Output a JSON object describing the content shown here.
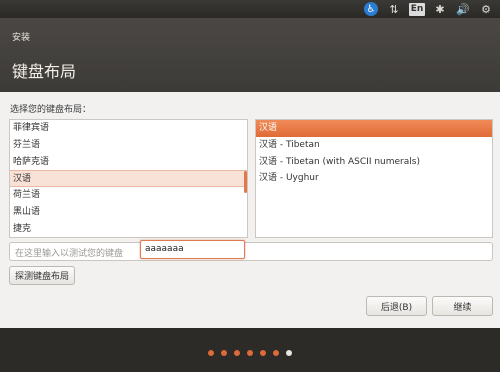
{
  "top_panel": {
    "keyboard_indicator": "En",
    "icons": [
      "accessibility-icon",
      "network-icon",
      "keyboard-layout-indicator",
      "bluetooth-icon",
      "volume-icon",
      "gear-icon"
    ]
  },
  "window": {
    "title": "安装",
    "page_title": "键盘布局"
  },
  "main": {
    "prompt": "选择您的键盘布局：",
    "languages": [
      "菲律宾语",
      "芬兰语",
      "哈萨克语",
      "汉语",
      "荷兰语",
      "黑山语",
      "捷克"
    ],
    "selected_language_index": 3,
    "variants": [
      "汉语",
      "汉语 - Tibetan",
      "汉语 - Tibetan (with ASCII numerals)",
      "汉语 - Uyghur"
    ],
    "selected_variant_index": 0,
    "test_placeholder": "在这里输入以测试您的键盘",
    "test_value": "aaaaaaa",
    "detect_button": "探测键盘布局",
    "back_button": "后退(B)",
    "continue_button": "继续"
  },
  "progress": {
    "total_steps": 7,
    "current_step": 7
  },
  "colors": {
    "accent": "#e06b37",
    "selection_bg": "#f8e1d6"
  }
}
